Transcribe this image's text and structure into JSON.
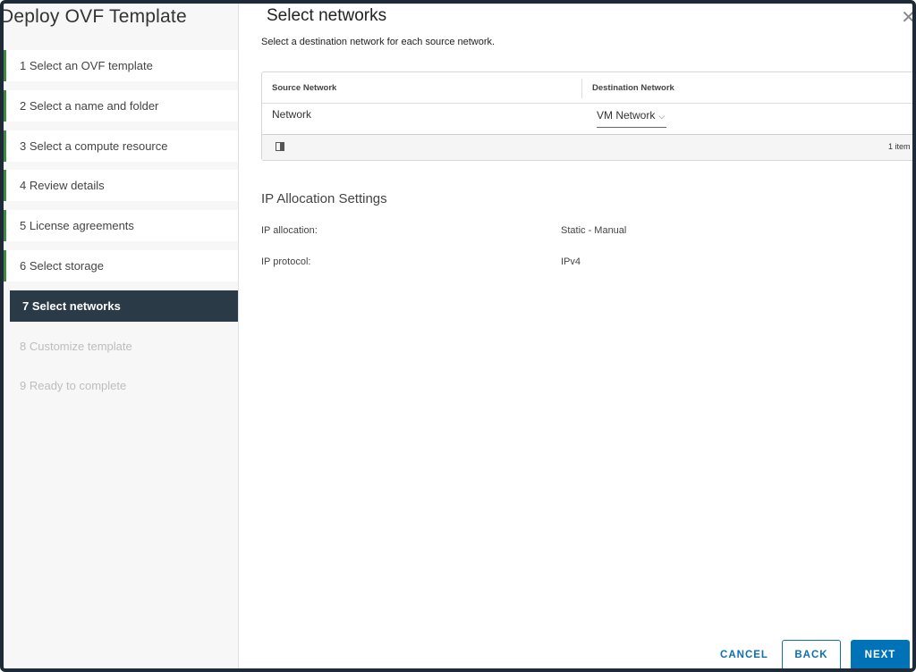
{
  "wizard": {
    "title": "Deploy OVF Template"
  },
  "steps": [
    {
      "label": "1  Select an OVF template",
      "state": "done"
    },
    {
      "label": "2  Select a name and folder",
      "state": "done"
    },
    {
      "label": "3  Select a compute resource",
      "state": "done"
    },
    {
      "label": "4  Review details",
      "state": "done"
    },
    {
      "label": "5  License agreements",
      "state": "done"
    },
    {
      "label": "6  Select storage",
      "state": "done"
    },
    {
      "label": "7  Select networks",
      "state": "active"
    },
    {
      "label": "8  Customize template",
      "state": "future"
    },
    {
      "label": "9  Ready to complete",
      "state": "future"
    }
  ],
  "page": {
    "title": "Select networks",
    "subtitle": "Select a destination network for each source network.",
    "close_icon": "close-icon"
  },
  "network_grid": {
    "columns": [
      "Source Network",
      "Destination Network"
    ],
    "rows": [
      {
        "source": "Network",
        "destination": "VM Network"
      }
    ],
    "column_toggle_icon": "column-toggle-icon",
    "footer_count": "1 item"
  },
  "ip_settings": {
    "title": "IP Allocation Settings",
    "allocation_label": "IP allocation:",
    "allocation_value": "Static - Manual",
    "protocol_label": "IP protocol:",
    "protocol_value": "IPv4"
  },
  "buttons": {
    "cancel": "CANCEL",
    "back": "BACK",
    "next": "NEXT"
  },
  "colors": {
    "active_step_bg": "#2a3b47",
    "primary_button": "#0072b8",
    "link_blue": "#0f6fb0",
    "completed_step_bar": "#3e8a3e"
  }
}
